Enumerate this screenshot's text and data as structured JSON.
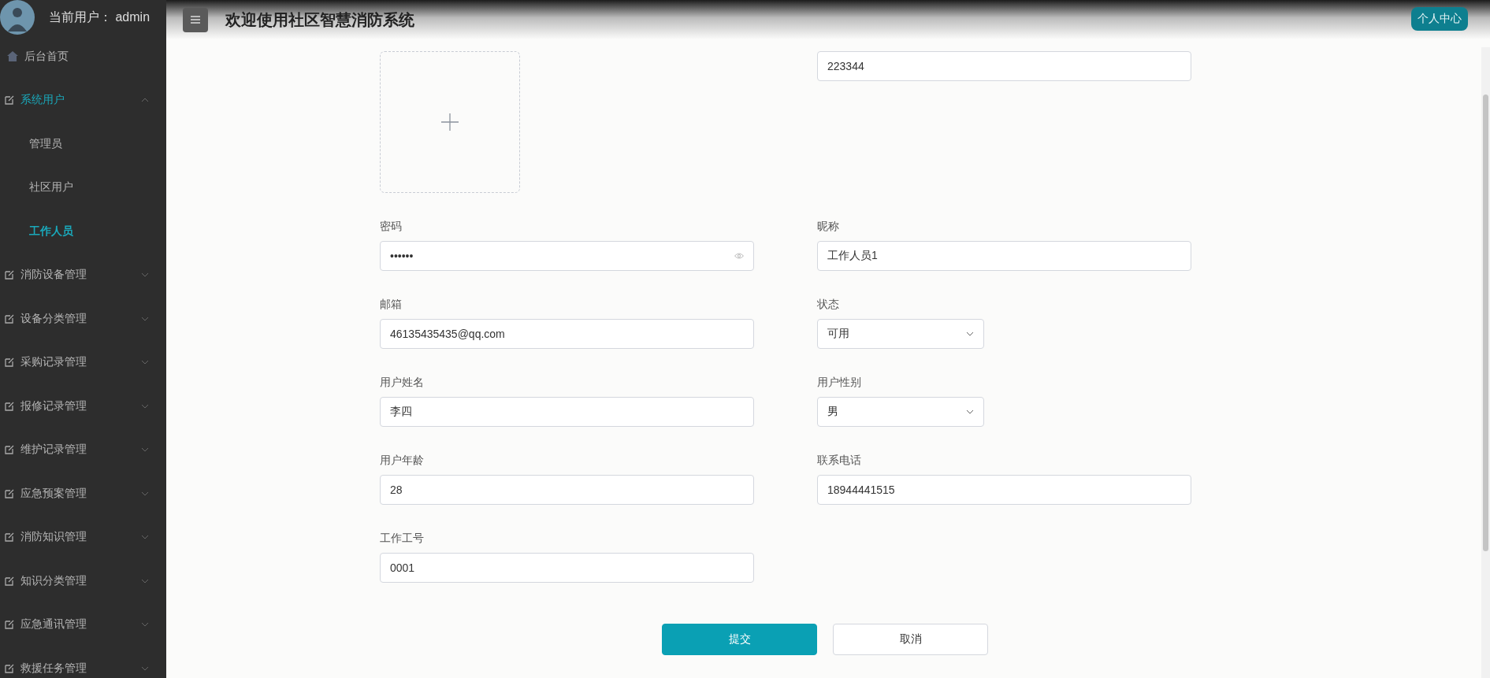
{
  "sidebar": {
    "user_label": "当前用户：",
    "user_name": "admin",
    "items": [
      {
        "label": "后台首页",
        "kind": "home"
      },
      {
        "label": "系统用户",
        "kind": "group",
        "expanded": true,
        "selected": true,
        "children": [
          {
            "label": "管理员",
            "selected": false
          },
          {
            "label": "社区用户",
            "selected": false
          },
          {
            "label": "工作人员",
            "selected": true
          }
        ]
      },
      {
        "label": "消防设备管理",
        "kind": "group",
        "expanded": false,
        "selected": false
      },
      {
        "label": "设备分类管理",
        "kind": "group",
        "expanded": false,
        "selected": false
      },
      {
        "label": "采购记录管理",
        "kind": "group",
        "expanded": false,
        "selected": false
      },
      {
        "label": "报修记录管理",
        "kind": "group",
        "expanded": false,
        "selected": false
      },
      {
        "label": "维护记录管理",
        "kind": "group",
        "expanded": false,
        "selected": false
      },
      {
        "label": "应急预案管理",
        "kind": "group",
        "expanded": false,
        "selected": false
      },
      {
        "label": "消防知识管理",
        "kind": "group",
        "expanded": false,
        "selected": false
      },
      {
        "label": "知识分类管理",
        "kind": "group",
        "expanded": false,
        "selected": false
      },
      {
        "label": "应急通讯管理",
        "kind": "group",
        "expanded": false,
        "selected": false
      },
      {
        "label": "救援任务管理",
        "kind": "group",
        "expanded": false,
        "selected": false
      }
    ]
  },
  "header": {
    "title": "欢迎使用社区智慧消防系统",
    "profile_button": "个人中心"
  },
  "form": {
    "top_field_value": "223344",
    "fields": [
      {
        "label": "密码",
        "kind": "password",
        "value": "••••••"
      },
      {
        "label": "昵称",
        "kind": "text",
        "value": "工作人员1"
      },
      {
        "label": "邮箱",
        "kind": "text",
        "value": "46135435435@qq.com"
      },
      {
        "label": "状态",
        "kind": "select",
        "value": "可用"
      },
      {
        "label": "用户姓名",
        "kind": "text",
        "value": "李四"
      },
      {
        "label": "用户性别",
        "kind": "select",
        "value": "男"
      },
      {
        "label": "用户年龄",
        "kind": "text",
        "value": "28"
      },
      {
        "label": "联系电话",
        "kind": "text",
        "value": "18944441515"
      },
      {
        "label": "工作工号",
        "kind": "text",
        "value": "0001"
      }
    ],
    "buttons": [
      {
        "label": "提交",
        "kind": "primary"
      },
      {
        "label": "取消",
        "kind": "default"
      }
    ]
  }
}
